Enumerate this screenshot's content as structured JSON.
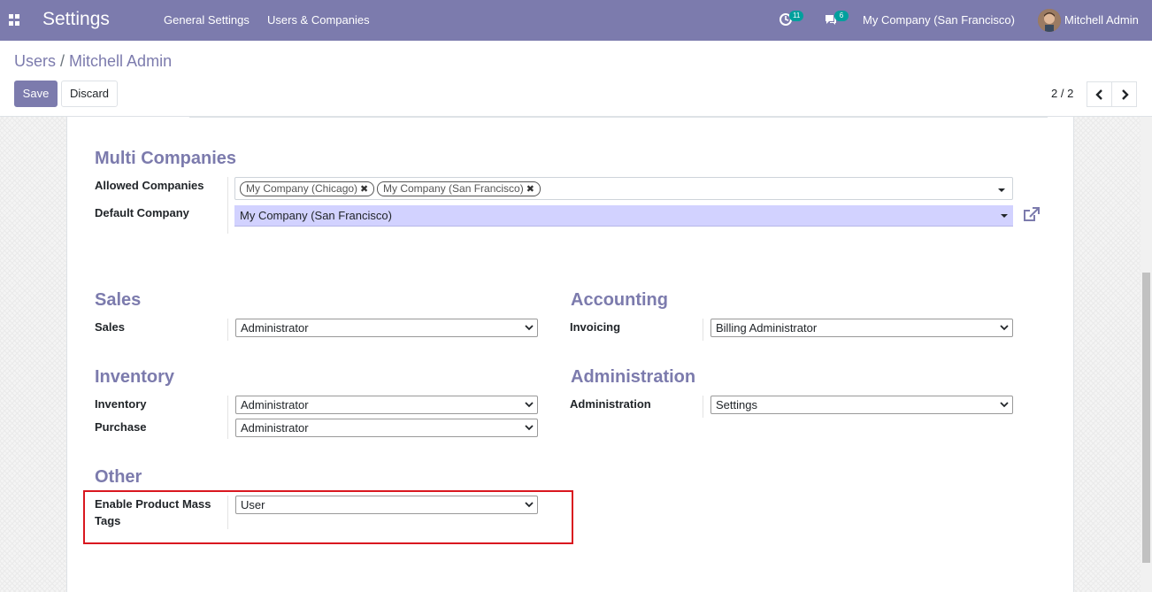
{
  "navbar": {
    "app_title": "Settings",
    "menu": [
      "General Settings",
      "Users & Companies"
    ],
    "activity_count": "11",
    "messages_count": "6",
    "company": "My Company (San Francisco)",
    "user": "Mitchell Admin"
  },
  "control_panel": {
    "breadcrumb_parent": "Users",
    "breadcrumb_sep": "/",
    "breadcrumb_current": "Mitchell Admin",
    "save_label": "Save",
    "discard_label": "Discard",
    "pager": "2 / 2"
  },
  "multi_companies": {
    "title": "Multi Companies",
    "allowed_label": "Allowed Companies",
    "allowed_tags": [
      "My Company (Chicago)",
      "My Company (San Francisco)"
    ],
    "default_label": "Default Company",
    "default_value": "My Company (San Francisco)"
  },
  "sales": {
    "title": "Sales",
    "fields": [
      {
        "label": "Sales",
        "value": "Administrator"
      }
    ]
  },
  "accounting": {
    "title": "Accounting",
    "fields": [
      {
        "label": "Invoicing",
        "value": "Billing Administrator"
      }
    ]
  },
  "inventory": {
    "title": "Inventory",
    "fields": [
      {
        "label": "Inventory",
        "value": "Administrator"
      },
      {
        "label": "Purchase",
        "value": "Administrator"
      }
    ]
  },
  "administration": {
    "title": "Administration",
    "fields": [
      {
        "label": "Administration",
        "value": "Settings"
      }
    ]
  },
  "other": {
    "title": "Other",
    "fields": [
      {
        "label": "Enable Product Mass Tags",
        "value": "User"
      }
    ]
  },
  "colors": {
    "brand": "#7c7bad",
    "badge": "#00a09d",
    "highlight": "#d9171f",
    "m2o_bg": "#d2d2ff"
  }
}
